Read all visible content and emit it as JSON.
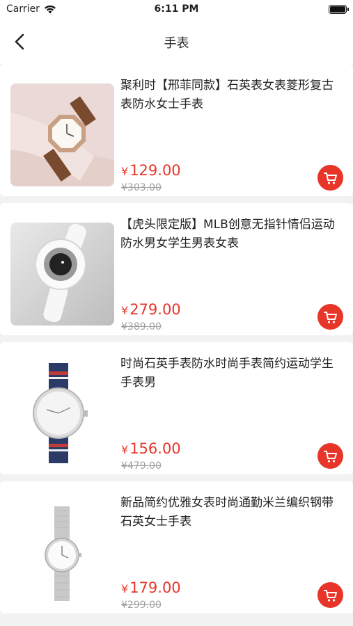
{
  "status_bar": {
    "carrier": "Carrier",
    "time": "6:11 PM"
  },
  "nav": {
    "title": "手表"
  },
  "products": [
    {
      "title": "聚利时【邢菲同款】石英表女表菱形复古表防水女士手表",
      "price": "129.00",
      "old_price": "¥303.00"
    },
    {
      "title": "【虎头限定版】MLB创意无指针情侣运动防水男女学生男表女表",
      "price": "279.00",
      "old_price": "¥389.00"
    },
    {
      "title": "时尚石英手表防水时尚手表简约运动学生手表男",
      "price": "156.00",
      "old_price": "¥479.00"
    },
    {
      "title": "新品简约优雅女表时尚通勤米兰编织钢带石英女士手表",
      "price": "179.00",
      "old_price": "¥299.00"
    }
  ],
  "currency_symbol": "¥",
  "colors": {
    "accent": "#e8352a",
    "background": "#f2f2f2"
  },
  "icons": {
    "back": "chevron-left-icon",
    "cart": "cart-icon",
    "wifi": "wifi-icon",
    "battery": "battery-icon"
  }
}
